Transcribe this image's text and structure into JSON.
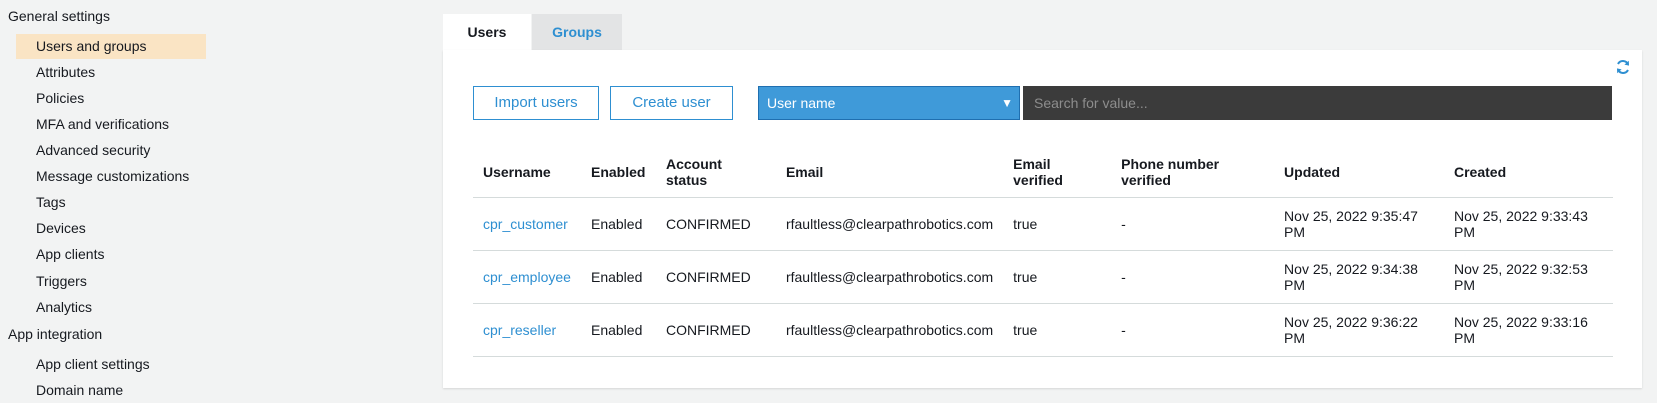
{
  "sidebar": {
    "general_settings": "General settings",
    "items": [
      {
        "label": "Users and groups"
      },
      {
        "label": "Attributes"
      },
      {
        "label": "Policies"
      },
      {
        "label": "MFA and verifications"
      },
      {
        "label": "Advanced security"
      },
      {
        "label": "Message customizations"
      },
      {
        "label": "Tags"
      },
      {
        "label": "Devices"
      },
      {
        "label": "App clients"
      },
      {
        "label": "Triggers"
      },
      {
        "label": "Analytics"
      }
    ],
    "app_integration": "App integration",
    "app_integration_items": [
      {
        "label": "App client settings"
      },
      {
        "label": "Domain name"
      }
    ]
  },
  "tabs": {
    "users": "Users",
    "groups": "Groups"
  },
  "toolbar": {
    "import_label": "Import users",
    "create_label": "Create user",
    "attribute_select": "User name",
    "search_placeholder": "Search for value..."
  },
  "table": {
    "headers": {
      "username": "Username",
      "enabled": "Enabled",
      "account_status": "Account status",
      "email": "Email",
      "email_verified": "Email verified",
      "phone_verified": "Phone number verified",
      "updated": "Updated",
      "created": "Created"
    },
    "rows": [
      {
        "username": "cpr_customer",
        "enabled": "Enabled",
        "status": "CONFIRMED",
        "email": "rfaultless@clearpathrobotics.com",
        "email_verified": "true",
        "phone_verified": "-",
        "updated": "Nov 25, 2022 9:35:47 PM",
        "created": "Nov 25, 2022 9:33:43 PM"
      },
      {
        "username": "cpr_employee",
        "enabled": "Enabled",
        "status": "CONFIRMED",
        "email": "rfaultless@clearpathrobotics.com",
        "email_verified": "true",
        "phone_verified": "-",
        "updated": "Nov 25, 2022 9:34:38 PM",
        "created": "Nov 25, 2022 9:32:53 PM"
      },
      {
        "username": "cpr_reseller",
        "enabled": "Enabled",
        "status": "CONFIRMED",
        "email": "rfaultless@clearpathrobotics.com",
        "email_verified": "true",
        "phone_verified": "-",
        "updated": "Nov 25, 2022 9:36:22 PM",
        "created": "Nov 25, 2022 9:33:16 PM"
      }
    ]
  },
  "colors": {
    "accent": "#2e8fd1",
    "active_nav": "#fae4c4",
    "select_bg": "#3f9ad9",
    "search_bg": "#3b3b3b"
  },
  "icons": {
    "refresh": "refresh-icon",
    "chevron": "chevron-down-icon"
  }
}
